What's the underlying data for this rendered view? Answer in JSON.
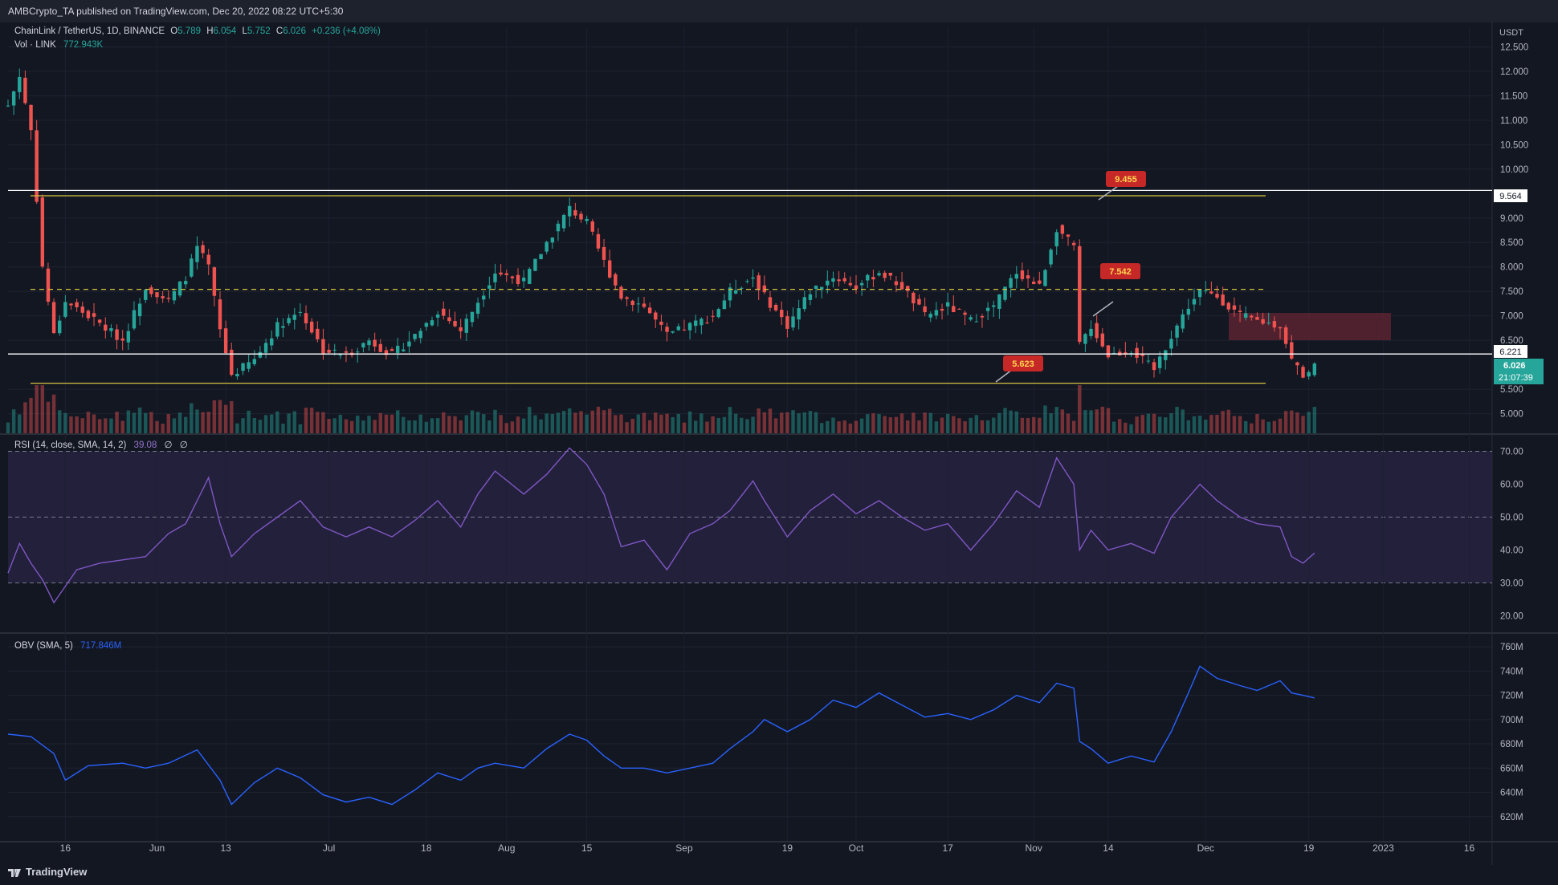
{
  "header": {
    "published": "AMBCrypto_TA published on TradingView.com, Dec 20, 2022 08:22 UTC+5:30"
  },
  "legend": {
    "symbol": "ChainLink / TetherUS, 1D, BINANCE",
    "o_label": "O",
    "o_value": "5.789",
    "h_label": "H",
    "h_value": "6.054",
    "l_label": "L",
    "l_value": "5.752",
    "c_label": "C",
    "c_value": "6.026",
    "change": "+0.236 (+4.08%)",
    "vol_label": "Vol · LINK",
    "vol_value": "772.943K"
  },
  "price_axis": {
    "currency": "USDT",
    "ticks": [
      "12.500",
      "12.000",
      "11.500",
      "11.000",
      "10.500",
      "10.000",
      "9.000",
      "8.500",
      "8.000",
      "7.500",
      "7.000",
      "6.500",
      "5.500",
      "5.000"
    ],
    "label_high": "9.564",
    "label_mid": "6.221",
    "label_last": "6.026",
    "label_countdown": "21:07:39"
  },
  "annotations": [
    {
      "text": "9.455"
    },
    {
      "text": "7.542"
    },
    {
      "text": "5.623"
    }
  ],
  "rsi": {
    "title": "RSI (14, close, SMA, 14, 2)",
    "value": "39.08",
    "extra1": "∅",
    "extra2": "∅",
    "ticks": [
      "70.00",
      "60.00",
      "50.00",
      "40.00",
      "30.00",
      "20.00"
    ]
  },
  "obv": {
    "title": "OBV (SMA, 5)",
    "value": "717.846M",
    "ticks": [
      "760M",
      "740M",
      "720M",
      "700M",
      "680M",
      "660M",
      "640M",
      "620M"
    ]
  },
  "time_axis": {
    "labels": [
      "16",
      "Jun",
      "13",
      "Jul",
      "18",
      "Aug",
      "15",
      "Sep",
      "19",
      "Oct",
      "17",
      "Nov",
      "14",
      "Dec",
      "19",
      "2023",
      "16"
    ]
  },
  "footer": {
    "brand": "TradingView"
  },
  "colors": {
    "bg": "#131722",
    "up": "#26a69a",
    "down": "#ef5350",
    "yellow": "#d4c13c",
    "rsi_line": "#7e57c2",
    "rsi_band": "#2a2445",
    "obv_line": "#2962ff",
    "zone": "#5b2330"
  },
  "chart_data": [
    {
      "type": "candlestick",
      "title": "ChainLink / TetherUS, 1D, BINANCE",
      "ylim": [
        4.6,
        12.9
      ],
      "x_range": [
        "2022-05-06",
        "2023-01-20"
      ],
      "last_candle": {
        "date": "2022-12-20",
        "open": 5.789,
        "high": 6.054,
        "low": 5.752,
        "close": 6.026
      },
      "horizontal_levels": [
        9.564,
        9.455,
        7.542,
        6.221,
        5.623
      ],
      "close_series": [
        [
          "2022-05-06",
          11.3
        ],
        [
          "2022-05-08",
          11.9
        ],
        [
          "2022-05-10",
          10.8
        ],
        [
          "2022-05-12",
          8.0
        ],
        [
          "2022-05-14",
          6.6
        ],
        [
          "2022-05-16",
          7.3
        ],
        [
          "2022-05-20",
          7.0
        ],
        [
          "2022-05-26",
          6.5
        ],
        [
          "2022-05-30",
          7.6
        ],
        [
          "2022-06-03",
          7.3
        ],
        [
          "2022-06-06",
          7.8
        ],
        [
          "2022-06-08",
          8.4
        ],
        [
          "2022-06-10",
          8.0
        ],
        [
          "2022-06-12",
          6.7
        ],
        [
          "2022-06-14",
          5.8
        ],
        [
          "2022-06-18",
          6.1
        ],
        [
          "2022-06-22",
          6.8
        ],
        [
          "2022-06-26",
          7.1
        ],
        [
          "2022-06-30",
          6.3
        ],
        [
          "2022-07-04",
          6.2
        ],
        [
          "2022-07-08",
          6.5
        ],
        [
          "2022-07-12",
          6.2
        ],
        [
          "2022-07-16",
          6.6
        ],
        [
          "2022-07-20",
          7.1
        ],
        [
          "2022-07-24",
          6.7
        ],
        [
          "2022-07-27",
          7.3
        ],
        [
          "2022-07-30",
          7.9
        ],
        [
          "2022-08-04",
          7.7
        ],
        [
          "2022-08-08",
          8.5
        ],
        [
          "2022-08-12",
          9.2
        ],
        [
          "2022-08-15",
          8.9
        ],
        [
          "2022-08-18",
          8.1
        ],
        [
          "2022-08-21",
          7.4
        ],
        [
          "2022-08-25",
          7.2
        ],
        [
          "2022-08-29",
          6.6
        ],
        [
          "2022-09-02",
          6.8
        ],
        [
          "2022-09-06",
          7.0
        ],
        [
          "2022-09-09",
          7.5
        ],
        [
          "2022-09-13",
          7.8
        ],
        [
          "2022-09-15",
          7.4
        ],
        [
          "2022-09-19",
          6.8
        ],
        [
          "2022-09-23",
          7.5
        ],
        [
          "2022-09-27",
          7.8
        ],
        [
          "2022-10-01",
          7.6
        ],
        [
          "2022-10-05",
          7.9
        ],
        [
          "2022-10-09",
          7.6
        ],
        [
          "2022-10-13",
          7.0
        ],
        [
          "2022-10-17",
          7.2
        ],
        [
          "2022-10-21",
          6.9
        ],
        [
          "2022-10-25",
          7.2
        ],
        [
          "2022-10-29",
          7.9
        ],
        [
          "2022-11-02",
          7.6
        ],
        [
          "2022-11-05",
          8.8
        ],
        [
          "2022-11-08",
          8.4
        ],
        [
          "2022-11-09",
          6.4
        ],
        [
          "2022-11-11",
          6.8
        ],
        [
          "2022-11-14",
          6.2
        ],
        [
          "2022-11-18",
          6.3
        ],
        [
          "2022-11-22",
          5.9
        ],
        [
          "2022-11-25",
          6.6
        ],
        [
          "2022-11-28",
          7.2
        ],
        [
          "2022-11-30",
          7.5
        ],
        [
          "2022-12-03",
          7.4
        ],
        [
          "2022-12-07",
          7.0
        ],
        [
          "2022-12-10",
          6.9
        ],
        [
          "2022-12-14",
          6.8
        ],
        [
          "2022-12-16",
          6.1
        ],
        [
          "2022-12-18",
          5.8
        ],
        [
          "2022-12-20",
          6.026
        ]
      ]
    },
    {
      "type": "line",
      "title": "RSI (14, close, SMA, 14, 2)",
      "ylim": [
        15,
        75
      ],
      "guides": [
        70,
        50,
        30
      ],
      "series": [
        {
          "values": [
            [
              "2022-05-06",
              33
            ],
            [
              "2022-05-08",
              42
            ],
            [
              "2022-05-10",
              36
            ],
            [
              "2022-05-12",
              31
            ],
            [
              "2022-05-14",
              24
            ],
            [
              "2022-05-16",
              29
            ],
            [
              "2022-05-18",
              34
            ],
            [
              "2022-05-22",
              36
            ],
            [
              "2022-05-26",
              37
            ],
            [
              "2022-05-30",
              38
            ],
            [
              "2022-06-03",
              45
            ],
            [
              "2022-06-06",
              48
            ],
            [
              "2022-06-08",
              55
            ],
            [
              "2022-06-10",
              62
            ],
            [
              "2022-06-12",
              48
            ],
            [
              "2022-06-14",
              38
            ],
            [
              "2022-06-18",
              45
            ],
            [
              "2022-06-22",
              50
            ],
            [
              "2022-06-26",
              55
            ],
            [
              "2022-06-30",
              47
            ],
            [
              "2022-07-04",
              44
            ],
            [
              "2022-07-08",
              47
            ],
            [
              "2022-07-12",
              44
            ],
            [
              "2022-07-16",
              49
            ],
            [
              "2022-07-20",
              55
            ],
            [
              "2022-07-24",
              47
            ],
            [
              "2022-07-27",
              57
            ],
            [
              "2022-07-30",
              64
            ],
            [
              "2022-08-04",
              57
            ],
            [
              "2022-08-08",
              63
            ],
            [
              "2022-08-12",
              71
            ],
            [
              "2022-08-15",
              66
            ],
            [
              "2022-08-18",
              57
            ],
            [
              "2022-08-21",
              41
            ],
            [
              "2022-08-25",
              43
            ],
            [
              "2022-08-29",
              34
            ],
            [
              "2022-09-02",
              45
            ],
            [
              "2022-09-06",
              48
            ],
            [
              "2022-09-09",
              52
            ],
            [
              "2022-09-13",
              61
            ],
            [
              "2022-09-15",
              55
            ],
            [
              "2022-09-19",
              44
            ],
            [
              "2022-09-23",
              52
            ],
            [
              "2022-09-27",
              57
            ],
            [
              "2022-10-01",
              51
            ],
            [
              "2022-10-05",
              55
            ],
            [
              "2022-10-09",
              50
            ],
            [
              "2022-10-13",
              46
            ],
            [
              "2022-10-17",
              48
            ],
            [
              "2022-10-21",
              40
            ],
            [
              "2022-10-25",
              48
            ],
            [
              "2022-10-29",
              58
            ],
            [
              "2022-11-02",
              53
            ],
            [
              "2022-11-05",
              68
            ],
            [
              "2022-11-08",
              60
            ],
            [
              "2022-11-09",
              40
            ],
            [
              "2022-11-11",
              46
            ],
            [
              "2022-11-14",
              40
            ],
            [
              "2022-11-18",
              42
            ],
            [
              "2022-11-22",
              39
            ],
            [
              "2022-11-25",
              50
            ],
            [
              "2022-11-28",
              56
            ],
            [
              "2022-11-30",
              60
            ],
            [
              "2022-12-03",
              55
            ],
            [
              "2022-12-07",
              50
            ],
            [
              "2022-12-10",
              48
            ],
            [
              "2022-12-14",
              47
            ],
            [
              "2022-12-16",
              38
            ],
            [
              "2022-12-18",
              36
            ],
            [
              "2022-12-20",
              39.08
            ]
          ]
        }
      ]
    },
    {
      "type": "line",
      "title": "OBV (SMA, 5)",
      "ylim": [
        600,
        770
      ],
      "series": [
        {
          "values": [
            [
              "2022-05-06",
              688
            ],
            [
              "2022-05-10",
              686
            ],
            [
              "2022-05-14",
              672
            ],
            [
              "2022-05-16",
              650
            ],
            [
              "2022-05-20",
              662
            ],
            [
              "2022-05-26",
              664
            ],
            [
              "2022-05-30",
              660
            ],
            [
              "2022-06-03",
              664
            ],
            [
              "2022-06-08",
              675
            ],
            [
              "2022-06-12",
              650
            ],
            [
              "2022-06-14",
              630
            ],
            [
              "2022-06-18",
              648
            ],
            [
              "2022-06-22",
              660
            ],
            [
              "2022-06-26",
              652
            ],
            [
              "2022-06-30",
              638
            ],
            [
              "2022-07-04",
              632
            ],
            [
              "2022-07-08",
              636
            ],
            [
              "2022-07-12",
              630
            ],
            [
              "2022-07-16",
              642
            ],
            [
              "2022-07-20",
              656
            ],
            [
              "2022-07-24",
              650
            ],
            [
              "2022-07-27",
              660
            ],
            [
              "2022-07-30",
              664
            ],
            [
              "2022-08-04",
              660
            ],
            [
              "2022-08-08",
              676
            ],
            [
              "2022-08-12",
              688
            ],
            [
              "2022-08-15",
              683
            ],
            [
              "2022-08-18",
              670
            ],
            [
              "2022-08-21",
              660
            ],
            [
              "2022-08-25",
              660
            ],
            [
              "2022-08-29",
              656
            ],
            [
              "2022-09-02",
              660
            ],
            [
              "2022-09-06",
              664
            ],
            [
              "2022-09-09",
              676
            ],
            [
              "2022-09-13",
              690
            ],
            [
              "2022-09-15",
              700
            ],
            [
              "2022-09-19",
              690
            ],
            [
              "2022-09-23",
              700
            ],
            [
              "2022-09-27",
              716
            ],
            [
              "2022-10-01",
              710
            ],
            [
              "2022-10-05",
              722
            ],
            [
              "2022-10-09",
              712
            ],
            [
              "2022-10-13",
              702
            ],
            [
              "2022-10-17",
              705
            ],
            [
              "2022-10-21",
              700
            ],
            [
              "2022-10-25",
              708
            ],
            [
              "2022-10-29",
              720
            ],
            [
              "2022-11-02",
              714
            ],
            [
              "2022-11-05",
              730
            ],
            [
              "2022-11-08",
              726
            ],
            [
              "2022-11-09",
              682
            ],
            [
              "2022-11-11",
              676
            ],
            [
              "2022-11-14",
              664
            ],
            [
              "2022-11-18",
              670
            ],
            [
              "2022-11-22",
              665
            ],
            [
              "2022-11-25",
              690
            ],
            [
              "2022-11-28",
              722
            ],
            [
              "2022-11-30",
              744
            ],
            [
              "2022-12-03",
              734
            ],
            [
              "2022-12-07",
              728
            ],
            [
              "2022-12-10",
              724
            ],
            [
              "2022-12-14",
              732
            ],
            [
              "2022-12-16",
              722
            ],
            [
              "2022-12-18",
              720
            ],
            [
              "2022-12-20",
              717.846
            ]
          ]
        }
      ]
    }
  ]
}
